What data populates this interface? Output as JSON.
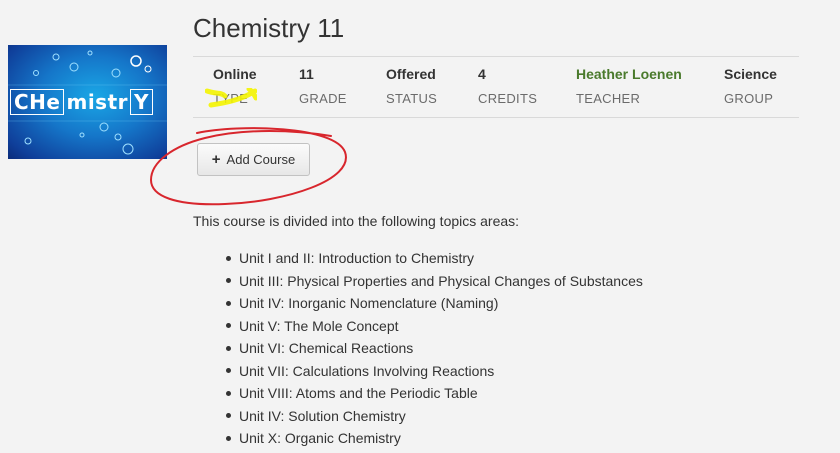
{
  "course": {
    "title": "Chemistry 11",
    "image_alt": "CHemistrY",
    "image_tiles": {
      "t1": "CHe",
      "t2": "mistr",
      "t3": "Y"
    }
  },
  "info": [
    {
      "value": "Online",
      "label": "TYPE"
    },
    {
      "value": "11",
      "label": "GRADE"
    },
    {
      "value": "Offered",
      "label": "STATUS"
    },
    {
      "value": "4",
      "label": "CREDITS"
    },
    {
      "value": "Heather Loenen",
      "label": "TEACHER"
    },
    {
      "value": "Science",
      "label": "GROUP"
    }
  ],
  "actions": {
    "add_course_label": "Add Course",
    "add_icon": "plus-icon"
  },
  "description": {
    "intro": "This course is divided into the following topics areas:",
    "topics": [
      "Unit I and II: Introduction to Chemistry",
      "Unit III: Physical Properties and Physical Changes of Substances",
      "Unit IV: Inorganic Nomenclature (Naming)",
      "Unit V: The Mole Concept",
      "Unit VI: Chemical Reactions",
      "Unit VII: Calculations Involving Reactions",
      "Unit VIII: Atoms and the Periodic Table",
      "Unit IV: Solution Chemistry",
      "Unit X: Organic Chemistry"
    ]
  },
  "colors": {
    "teacher": "#4a7a2c",
    "annotation_red": "#d8262d",
    "annotation_yellow": "#f4f400"
  }
}
